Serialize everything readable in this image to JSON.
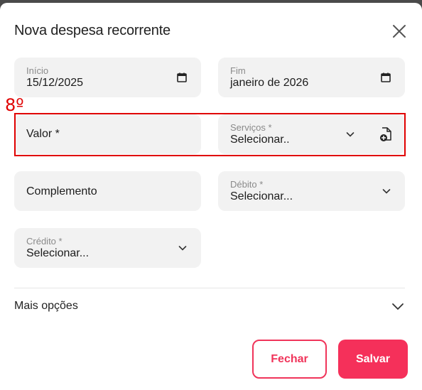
{
  "modal": {
    "title": "Nova despesa recorrente"
  },
  "form": {
    "inicio": {
      "label": "Início",
      "value": "15/12/2025"
    },
    "fim": {
      "label": "Fim",
      "value": "janeiro de 2026"
    },
    "valor": {
      "placeholder": "Valor *"
    },
    "servicos": {
      "label": "Serviços *",
      "value": "Selecionar.."
    },
    "complemento": {
      "placeholder": "Complemento"
    },
    "debito": {
      "label": "Débito *",
      "value": "Selecionar..."
    },
    "credito": {
      "label": "Crédito *",
      "value": "Selecionar..."
    }
  },
  "annotation": {
    "label": "8º",
    "color": "#e00000"
  },
  "more_options": {
    "label": "Mais opções"
  },
  "buttons": {
    "close_label": "Fechar",
    "save_label": "Salvar"
  },
  "colors": {
    "accent": "#f5305a",
    "field_bg": "#f2f2f2"
  },
  "icons": [
    "close-icon",
    "calendar-icon",
    "chevron-down-icon",
    "file-add-icon"
  ]
}
